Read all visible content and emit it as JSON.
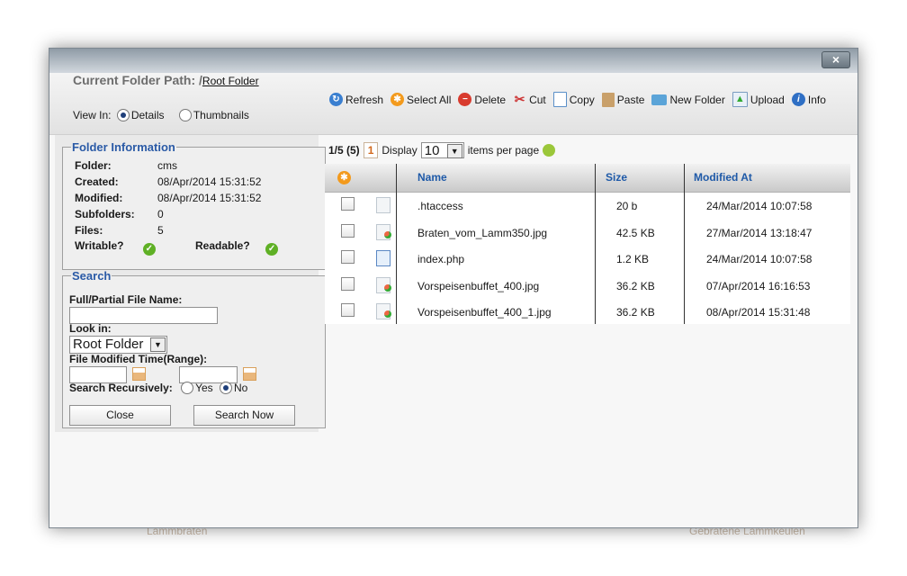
{
  "background": {
    "left_text": "Lammbraten",
    "right_text": "Gebratene Lammkeulen"
  },
  "dialog": {
    "close_label": "×"
  },
  "header": {
    "path_label": "Current Folder Path: /",
    "path_link": "Root Folder",
    "view_in_label": "View In:",
    "view_details": "Details",
    "view_thumbnails": "Thumbnails",
    "selected_view": "Details"
  },
  "toolbar": [
    {
      "label": "Refresh",
      "icon": "refresh-icon"
    },
    {
      "label": "Select All",
      "icon": "select-all-icon"
    },
    {
      "label": "Delete",
      "icon": "delete-icon"
    },
    {
      "label": "Cut",
      "icon": "scissors-icon"
    },
    {
      "label": "Copy",
      "icon": "copy-icon"
    },
    {
      "label": "Paste",
      "icon": "paste-icon"
    },
    {
      "label": "New Folder",
      "icon": "new-folder-icon"
    },
    {
      "label": "Upload",
      "icon": "upload-icon"
    },
    {
      "label": "Info",
      "icon": "info-icon"
    }
  ],
  "folder_info": {
    "title": "Folder Information",
    "folder_label": "Folder:",
    "folder": "cms",
    "created_label": "Created:",
    "created": "08/Apr/2014 15:31:52",
    "modified_label": "Modified:",
    "modified": "08/Apr/2014 15:31:52",
    "subfolders_label": "Subfolders:",
    "subfolders": "0",
    "files_label": "Files:",
    "files": "5",
    "writable_label": "Writable?",
    "readable_label": "Readable?"
  },
  "search": {
    "title": "Search",
    "filename_label": "Full/Partial File Name:",
    "filename_value": "",
    "look_in_label": "Look in:",
    "look_in_value": "Root Folder",
    "modified_range_label": "File Modified Time(Range):",
    "recursive_label": "Search Recursively:",
    "yes_label": "Yes",
    "no_label": "No",
    "recursive_selected": "No",
    "close_button": "Close",
    "search_button": "Search Now"
  },
  "pager": {
    "page_info": "1/5 (5)",
    "page_button": "1",
    "display_label": "Display",
    "per_page_value": "10",
    "per_page_suffix": "items per page"
  },
  "grid": {
    "columns": {
      "name": "Name",
      "size": "Size",
      "modified": "Modified At"
    },
    "rows": [
      {
        "name": ".htaccess",
        "size": "20 b",
        "modified": "24/Mar/2014 10:07:58",
        "type": "file"
      },
      {
        "name": "Braten_vom_Lamm350.jpg",
        "size": "42.5 KB",
        "modified": "27/Mar/2014 13:18:47",
        "type": "image"
      },
      {
        "name": "index.php",
        "size": "1.2 KB",
        "modified": "24/Mar/2014 10:07:58",
        "type": "php"
      },
      {
        "name": "Vorspeisenbuffet_400.jpg",
        "size": "36.2 KB",
        "modified": "07/Apr/2014 16:16:53",
        "type": "image"
      },
      {
        "name": "Vorspeisenbuffet_400_1.jpg",
        "size": "36.2 KB",
        "modified": "08/Apr/2014 15:31:48",
        "type": "image"
      }
    ]
  }
}
